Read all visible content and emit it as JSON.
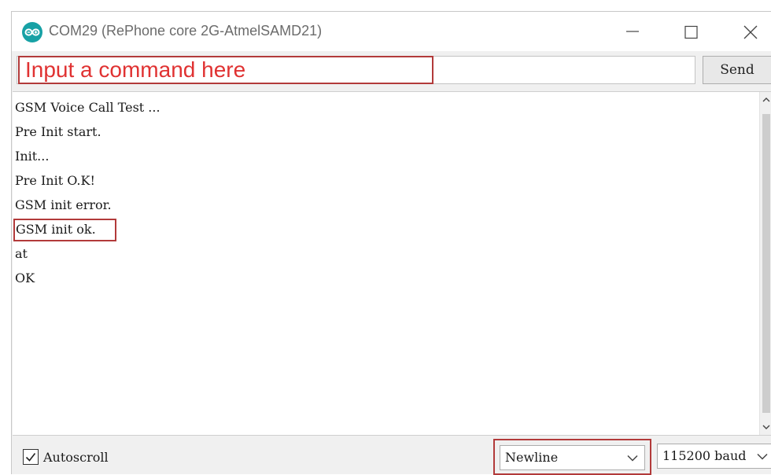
{
  "window": {
    "title": "COM29 (RePhone core 2G-AtmelSAMD21)",
    "app_icon": "arduino-icon",
    "controls": [
      "minimize-icon",
      "maximize-icon",
      "close-icon"
    ]
  },
  "command": {
    "placeholder": "Input a command here",
    "send_label": "Send"
  },
  "output": {
    "lines": [
      "GSM Voice Call Test ...",
      "Pre Init start.",
      "Init...",
      "Pre Init O.K!",
      "GSM init error.",
      "GSM init ok.",
      "at",
      "OK"
    ]
  },
  "bottom": {
    "autoscroll_label": "Autoscroll",
    "autoscroll_checked": true,
    "line_ending": "Newline",
    "baud_rate": "115200 baud"
  },
  "colors": {
    "annotation": "#b23a3a",
    "placeholder_text": "#e03232",
    "arduino_teal": "#17a1a5"
  }
}
